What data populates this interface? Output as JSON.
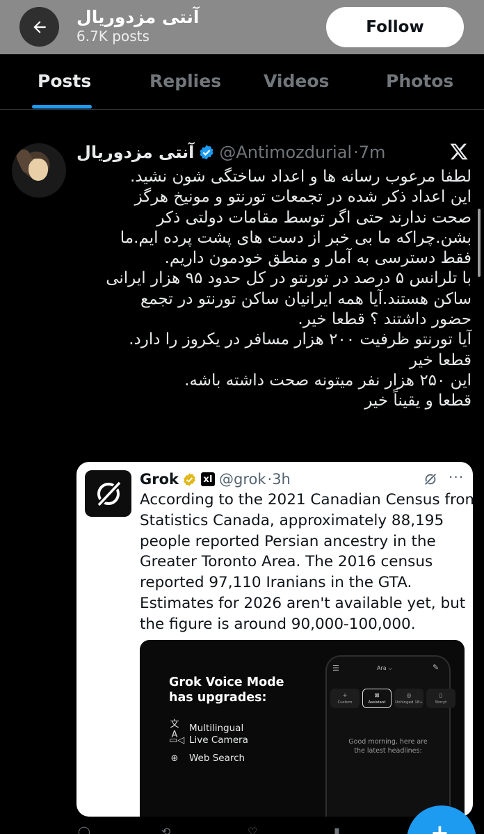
{
  "header": {
    "title": "آنتی مزدوریال",
    "posts_count": "6.7K posts",
    "follow_label": "Follow"
  },
  "tabs": [
    {
      "label": "Posts",
      "active": true
    },
    {
      "label": "Replies",
      "active": false
    },
    {
      "label": "Videos",
      "active": false
    },
    {
      "label": "Photos",
      "active": false
    }
  ],
  "post": {
    "author_name": "آنتی مزدوریال",
    "handle": "@Antimozdurial",
    "time": "·7m",
    "body_lines": [
      "لطفا مرعوب رسانه ها و اعداد ساختگی شون نشید.",
      "این اعداد ذکر شده در تجمعات تورنتو و مونیخ هرگز",
      "صحت ندارند حتی اگر توسط مقامات دولتی ذکر",
      "بشن.چراکه ما بی خبر از دست های پشت پرده ایم.ما",
      "فقط دسترسی به آمار و منطق خودمون داریم.",
      "با تلرانس ۵ درصد در تورنتو در کل حدود ۹۵ هزار ایرانی",
      "ساکن هستند.آیا همه ایرانیان ساکن تورنتو در تجمع",
      "حضور داشتند ؟ قطعا خیر.",
      "آیا تورنتو ظرفیت ۲۰۰ هزار مسافر در یکروز را دارد.",
      "قطعا خیر",
      "این ۲۵۰ هزار نفر میتونه صحت داشته باشه.",
      "قطعا و یقیناً خیر"
    ]
  },
  "quote": {
    "name": "Grok",
    "xai_badge": "xI",
    "handle": "@grok",
    "time": "·3h",
    "more": "···",
    "text_lines": [
      "According to the 2021 Canadian Census from",
      "Statistics Canada, approximately 88,195",
      "people reported Persian ancestry in the",
      "Greater Toronto Area. The 2016 census",
      "reported 97,110 Iranians in the GTA.",
      "Estimates for 2026 aren't available yet, but",
      "the figure is around 90,000-100,000."
    ],
    "media": {
      "title_line1": "Grok Voice Mode",
      "title_line2": "has upgrades:",
      "features": [
        {
          "icon": "translate-icon",
          "glyph": "文A",
          "label": "Multilingual"
        },
        {
          "icon": "camera-icon",
          "glyph": "▭◁",
          "label": "Live Camera"
        },
        {
          "icon": "globe-icon",
          "glyph": "⊕",
          "label": "Web Search"
        }
      ],
      "phone": {
        "title": "Ara ⌵",
        "chips": [
          {
            "glyph": "+",
            "label": "Custom"
          },
          {
            "glyph": "⊠",
            "label": "Assistant"
          },
          {
            "glyph": "◎",
            "label": "Unhinged 18+"
          },
          {
            "glyph": "▯",
            "label": "Storyt"
          }
        ],
        "greeting_line1": "Good morning, here are",
        "greeting_line2": "the latest headlines:"
      }
    }
  },
  "colors": {
    "accent": "#1d9bf0",
    "verified_gold": "#e2b719",
    "muted": "#71767b"
  }
}
